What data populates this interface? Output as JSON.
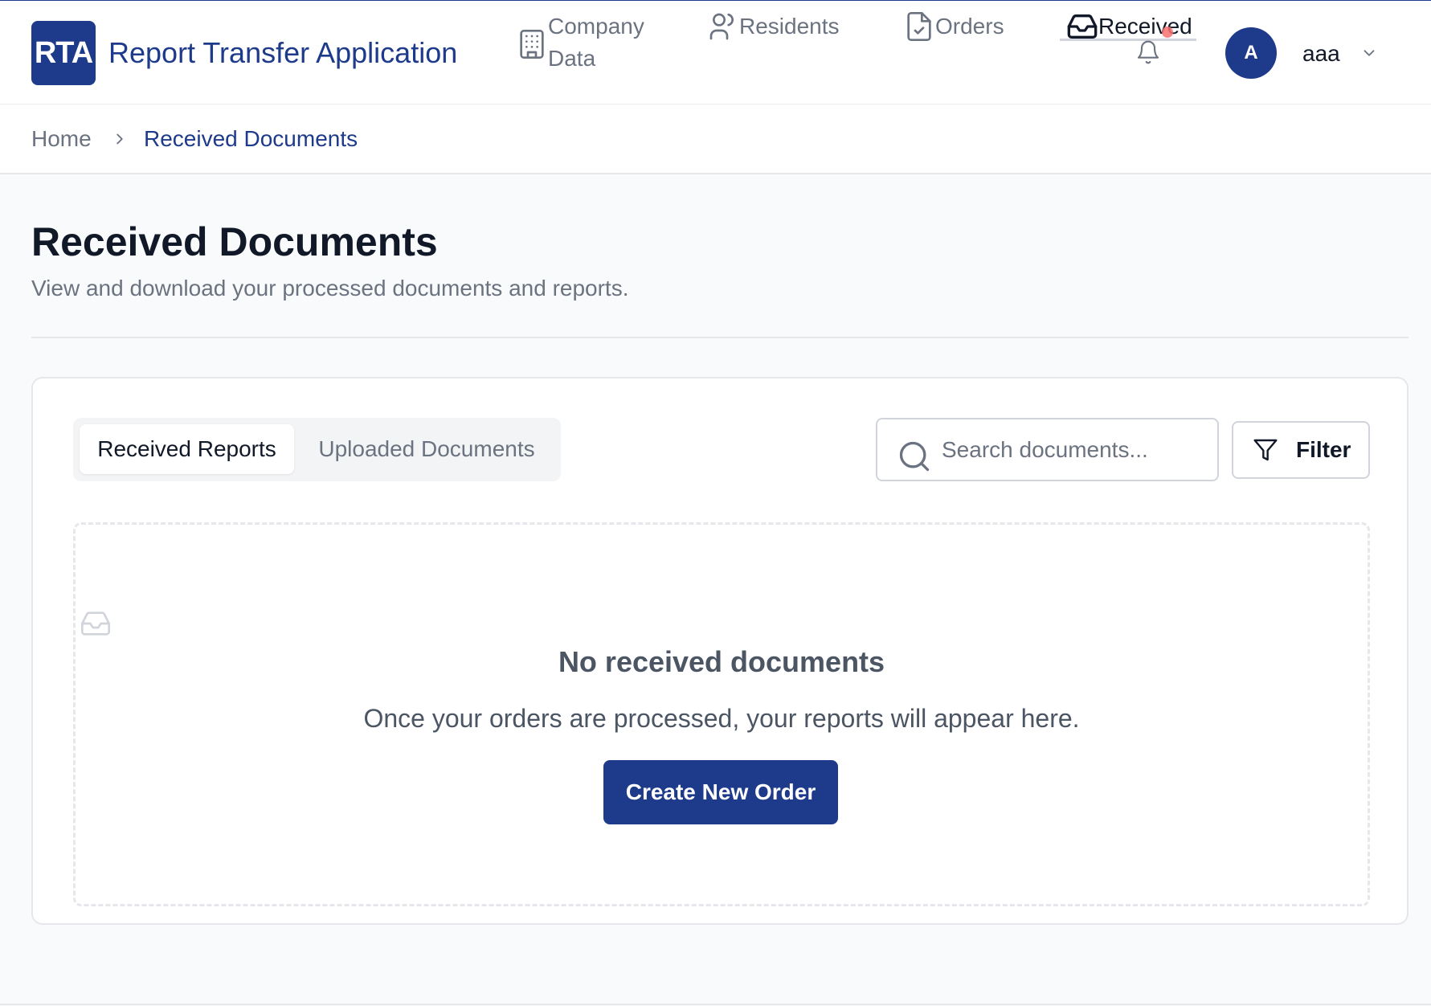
{
  "header": {
    "logo_text": "RTA",
    "app_title": "Report Transfer Application",
    "nav": [
      {
        "label": "Company Data",
        "icon": "building-icon"
      },
      {
        "label": "Residents",
        "icon": "users-icon"
      },
      {
        "label": "Orders",
        "icon": "file-check-icon"
      },
      {
        "label": "Received",
        "icon": "inbox-icon",
        "active": true
      }
    ],
    "notification_icon": "bell-icon",
    "user": {
      "avatar_initial": "A",
      "name": "aaa"
    }
  },
  "breadcrumb": {
    "home": "Home",
    "current": "Received Documents"
  },
  "page": {
    "title": "Received Documents",
    "subtitle": "View and download your processed documents and reports."
  },
  "tabs": [
    {
      "label": "Received Reports",
      "active": true
    },
    {
      "label": "Uploaded Documents",
      "active": false
    }
  ],
  "search": {
    "placeholder": "Search documents...",
    "value": ""
  },
  "filter": {
    "label": "Filter"
  },
  "empty_state": {
    "icon": "inbox-icon",
    "title": "No received documents",
    "text": "Once your orders are processed, your reports will appear here.",
    "button_label": "Create New Order"
  },
  "colors": {
    "brand": "#1e3a8a",
    "notification_dot": "#f87171"
  }
}
